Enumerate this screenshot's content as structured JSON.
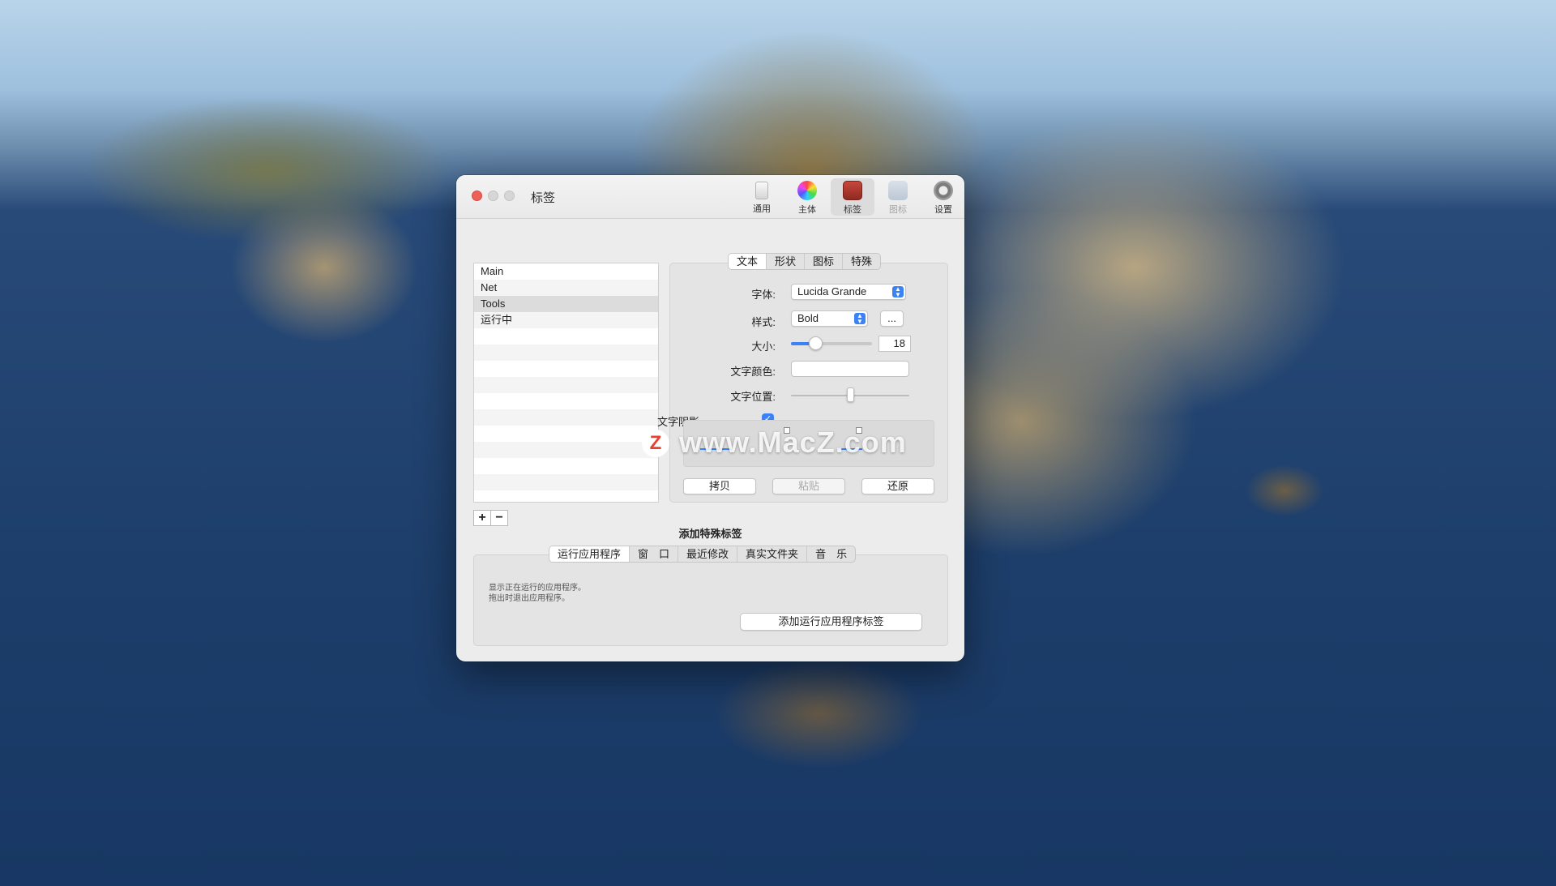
{
  "window": {
    "title": "标签",
    "toolbar": [
      {
        "label": "通用",
        "icon": "general-icon"
      },
      {
        "label": "主体",
        "icon": "theme-color-icon"
      },
      {
        "label": "标签",
        "icon": "tags-icon"
      },
      {
        "label": "图标",
        "icon": "icons-icon"
      },
      {
        "label": "设置",
        "icon": "settings-gear-icon"
      }
    ]
  },
  "tag_list": {
    "items": [
      "Main",
      "Net",
      "Tools",
      "运行中"
    ],
    "selected": "Tools",
    "add_label": "+",
    "remove_label": "−"
  },
  "editor": {
    "tabs": [
      "文本",
      "形状",
      "图标",
      "特殊"
    ],
    "active_tab": "文本",
    "font_label": "字体:",
    "font_value": "Lucida Grande",
    "style_label": "样式:",
    "style_value": "Bold",
    "style_more": "...",
    "size_label": "大小:",
    "size_value": "18",
    "size_fraction": 0.3,
    "text_color_label": "文字颜色:",
    "text_color_value": "#ffffff",
    "text_position_label": "文字位置:",
    "text_position_fraction": 0.5,
    "shadow_label": "文字阴影",
    "shadow_checked": "✓",
    "copy_label": "拷贝",
    "paste_label": "粘贴",
    "restore_label": "还原"
  },
  "special": {
    "title": "添加特殊标签",
    "tabs": [
      "运行应用程序",
      "窗　口",
      "最近修改",
      "真实文件夹",
      "音　乐"
    ],
    "active_tab": "运行应用程序",
    "description_line1": "显示正在运行的应用程序。",
    "description_line2": "拖出时退出应用程序。",
    "add_button": "添加运行应用程序标签"
  },
  "watermark": {
    "text": "www.MacZ.com",
    "logo": "Z"
  },
  "colors": {
    "accent": "#3b82f6",
    "close": "#ee5f57",
    "window_bg": "#ececec"
  }
}
